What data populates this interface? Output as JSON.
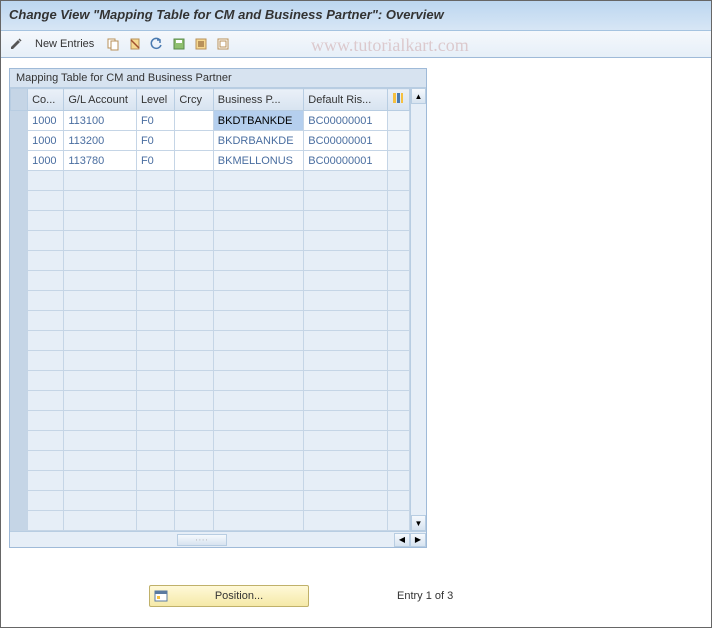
{
  "header": {
    "title": "Change View \"Mapping Table for CM and Business Partner\": Overview"
  },
  "toolbar": {
    "new_entries_label": "New Entries"
  },
  "watermark": "www.tutorialkart.com",
  "table": {
    "title": "Mapping Table for CM and Business Partner",
    "columns": {
      "co": "Co...",
      "gl": "G/L Account",
      "level": "Level",
      "crcy": "Crcy",
      "bp": "Business P...",
      "risk": "Default Ris..."
    },
    "rows": [
      {
        "co": "1000",
        "gl": "113100",
        "level": "F0",
        "crcy": "",
        "bp": "BKDTBANKDE",
        "risk": "BC00000001",
        "bp_selected": true
      },
      {
        "co": "1000",
        "gl": "113200",
        "level": "F0",
        "crcy": "",
        "bp": "BKDRBANKDE",
        "risk": "BC00000001",
        "bp_selected": false
      },
      {
        "co": "1000",
        "gl": "113780",
        "level": "F0",
        "crcy": "",
        "bp": "BKMELLONUS",
        "risk": "BC00000001",
        "bp_selected": false
      }
    ]
  },
  "footer": {
    "position_label": "Position...",
    "entry_text": "Entry 1 of 3"
  }
}
